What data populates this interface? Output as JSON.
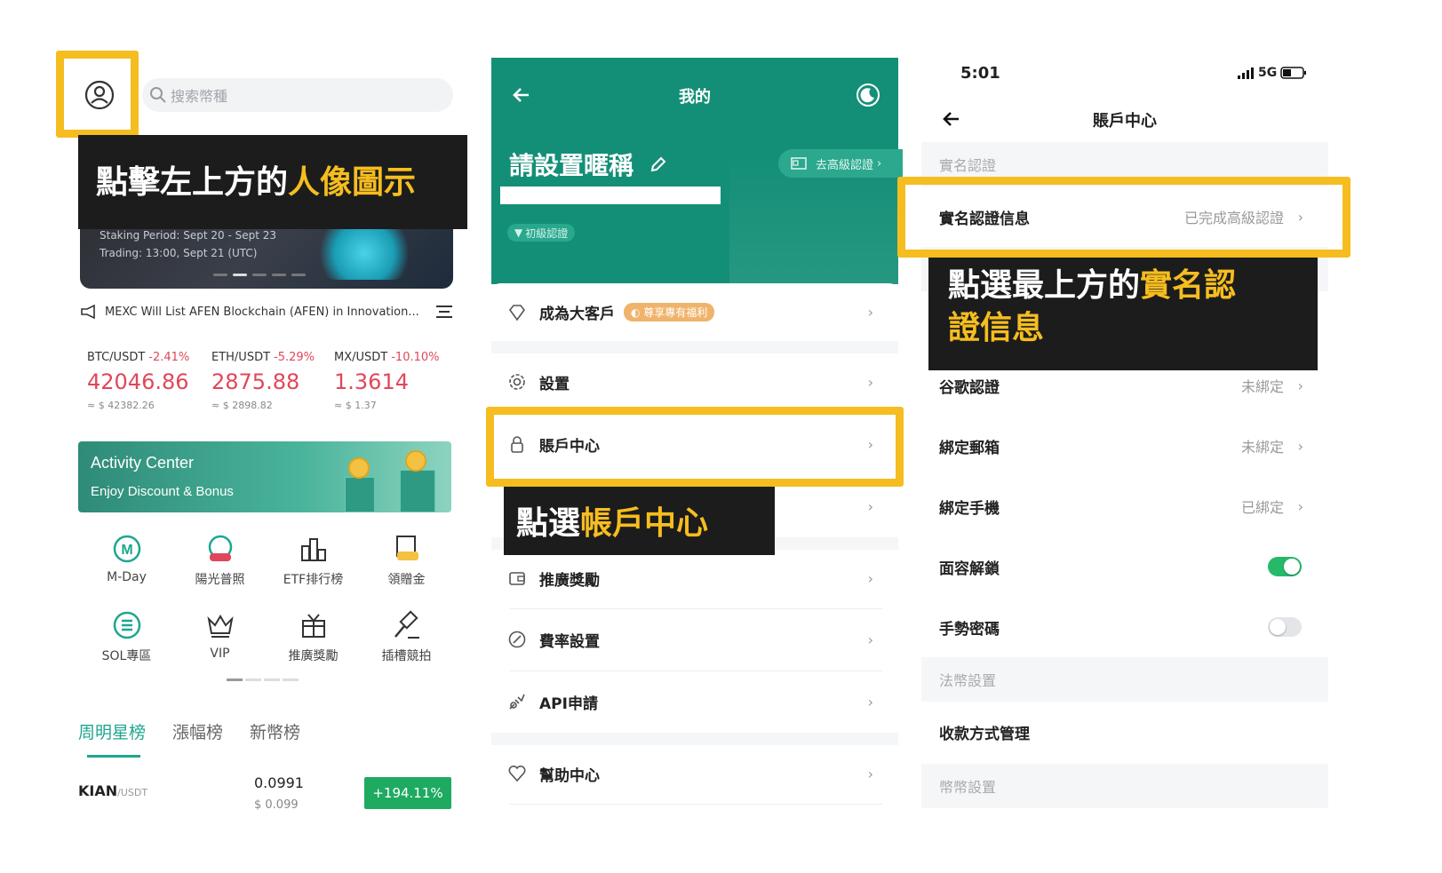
{
  "panel1": {
    "search_placeholder": "搜索幣種",
    "caption": {
      "prefix": "點擊左上方的",
      "highlight": "人像圖示"
    },
    "banner_lines": [
      "Staking Period: Sept 20 - Sept 23",
      "Trading: 13:00, Sept 21 (UTC)"
    ],
    "notice": "MEXC Will List AFEN Blockchain (AFEN) in Innovation...",
    "tickers": [
      {
        "pair": "BTC/USDT",
        "change": "-2.41%",
        "price": "42046.86",
        "usd": "≈ $ 42382.26"
      },
      {
        "pair": "ETH/USDT",
        "change": "-5.29%",
        "price": "2875.88",
        "usd": "≈ $ 2898.82"
      },
      {
        "pair": "MX/USDT",
        "change": "-10.10%",
        "price": "1.3614",
        "usd": "≈ $ 1.37"
      }
    ],
    "activity": {
      "title": "Activity Center",
      "subtitle": "Enjoy Discount & Bonus"
    },
    "shortcuts": [
      {
        "label": "M-Day",
        "icon": "m-day-icon"
      },
      {
        "label": "陽光普照",
        "icon": "hot-icon"
      },
      {
        "label": "ETF排行榜",
        "icon": "etf-icon"
      },
      {
        "label": "領贈金",
        "icon": "bonus-icon"
      },
      {
        "label": "SOL專區",
        "icon": "sol-icon"
      },
      {
        "label": "VIP",
        "icon": "vip-crown-icon"
      },
      {
        "label": "推廣獎勵",
        "icon": "gift-icon"
      },
      {
        "label": "插槽競拍",
        "icon": "auction-hammer-icon"
      }
    ],
    "tabs": [
      "周明星榜",
      "漲幅榜",
      "新幣榜"
    ],
    "market_row": {
      "symbol": "KIAN",
      "quote": "/USDT",
      "price": "0.0991",
      "usd": "$ 0.099",
      "change": "+194.11%"
    },
    "colors": {
      "accent": "#1da68f",
      "down": "#e0475a",
      "highlight": "#f5bd1f"
    }
  },
  "panel2": {
    "title": "我的",
    "nickname": "請設置暱稱",
    "advanced_badge": "去高級認證",
    "level_badge": "初級認證",
    "vip": {
      "label": "成為大客戶",
      "tag": "尊享專有福利"
    },
    "items": {
      "settings": "設置",
      "account": "賬戶中心",
      "referral": "推廣獎勵",
      "fees": "費率設置",
      "api": "API申請",
      "help": "幫助中心"
    },
    "caption": {
      "prefix": "點選",
      "highlight": "帳戶中心"
    }
  },
  "panel3": {
    "status_time": "5:01",
    "network": "5G",
    "title": "賬戶中心",
    "section_kyc": "實名認證",
    "kyc_row": {
      "label": "實名認證信息",
      "value": "已完成高級認證"
    },
    "caption": {
      "prefix": "點選最上方的",
      "highlight1": "實名認",
      "highlight2": "證信息"
    },
    "rows": [
      {
        "label": "谷歌認證",
        "value": "未綁定"
      },
      {
        "label": "綁定郵箱",
        "value": "未綁定"
      },
      {
        "label": "綁定手機",
        "value": "已綁定"
      }
    ],
    "face_unlock": {
      "label": "面容解鎖",
      "enabled": true
    },
    "gesture": {
      "label": "手勢密碼",
      "enabled": false
    },
    "section_fiat": "法幣設置",
    "payment": "收款方式管理",
    "section_coin": "幣幣設置"
  }
}
